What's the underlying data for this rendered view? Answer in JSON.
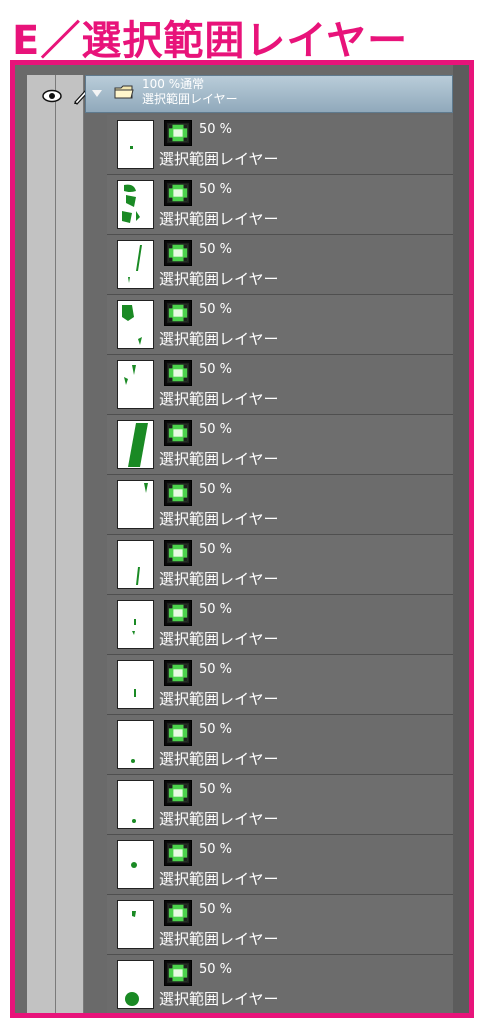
{
  "title": "E／選択範囲レイヤー",
  "folder": {
    "opacity_mode": "100 %通常",
    "name": "選択範囲レイヤー"
  },
  "colors": {
    "accent_pink": "#e8137a",
    "panel_bg": "#6a6a6a",
    "folder_bar": "#a8bfcd",
    "thumb_green": "#1a8a24"
  },
  "layers": [
    {
      "opacity": "50 %",
      "name": "選択範囲レイヤー"
    },
    {
      "opacity": "50 %",
      "name": "選択範囲レイヤー"
    },
    {
      "opacity": "50 %",
      "name": "選択範囲レイヤー"
    },
    {
      "opacity": "50 %",
      "name": "選択範囲レイヤー"
    },
    {
      "opacity": "50 %",
      "name": "選択範囲レイヤー"
    },
    {
      "opacity": "50 %",
      "name": "選択範囲レイヤー"
    },
    {
      "opacity": "50 %",
      "name": "選択範囲レイヤー"
    },
    {
      "opacity": "50 %",
      "name": "選択範囲レイヤー"
    },
    {
      "opacity": "50 %",
      "name": "選択範囲レイヤー"
    },
    {
      "opacity": "50 %",
      "name": "選択範囲レイヤー"
    },
    {
      "opacity": "50 %",
      "name": "選択範囲レイヤー"
    },
    {
      "opacity": "50 %",
      "name": "選択範囲レイヤー"
    },
    {
      "opacity": "50 %",
      "name": "選択範囲レイヤー"
    },
    {
      "opacity": "50 %",
      "name": "選択範囲レイヤー"
    },
    {
      "opacity": "50 %",
      "name": "選択範囲レイヤー"
    }
  ],
  "icons": {
    "visibility": "eye-icon",
    "lock": "pen-icon",
    "expand": "triangle-down-icon",
    "folder": "folder-icon",
    "selection": "selection-layer-icon"
  }
}
